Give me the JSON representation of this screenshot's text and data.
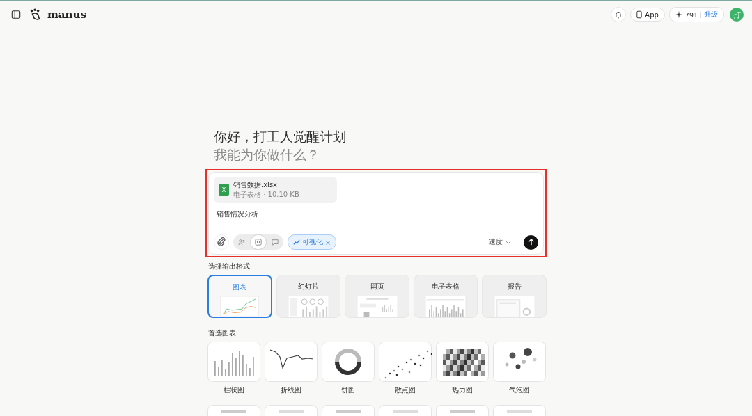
{
  "header": {
    "brand": "manus",
    "app_button": "App",
    "credits": "791",
    "upgrade": "升级",
    "avatar": "打"
  },
  "greeting": {
    "line1": "你好，打工人觉醒计划",
    "line2": "我能为你做什么？"
  },
  "composer": {
    "highlighted": true,
    "attachment": {
      "name": "销售数据.xlsx",
      "meta": "电子表格 · 10.10 KB",
      "badge": "X"
    },
    "text": "销售情况分析",
    "modes": [
      {
        "kind": "agent",
        "selected": false
      },
      {
        "kind": "grid",
        "selected": true
      },
      {
        "kind": "chat",
        "selected": false
      }
    ],
    "chip": {
      "label": "可视化",
      "close": "×"
    },
    "speed": "速度"
  },
  "formats": {
    "title": "选择输出格式",
    "items": [
      {
        "label": "图表",
        "kind": "chart",
        "selected": true
      },
      {
        "label": "幻灯片",
        "kind": "slides",
        "selected": false
      },
      {
        "label": "网页",
        "kind": "web",
        "selected": false
      },
      {
        "label": "电子表格",
        "kind": "sheet",
        "selected": false
      },
      {
        "label": "报告",
        "kind": "report",
        "selected": false
      }
    ]
  },
  "charts": {
    "title": "首选图表",
    "items": [
      {
        "label": "柱状图",
        "kind": "bar"
      },
      {
        "label": "折线图",
        "kind": "line"
      },
      {
        "label": "饼图",
        "kind": "donut"
      },
      {
        "label": "散点图",
        "kind": "scatter"
      },
      {
        "label": "热力图",
        "kind": "heat"
      },
      {
        "label": "气泡图",
        "kind": "bubble"
      }
    ]
  }
}
